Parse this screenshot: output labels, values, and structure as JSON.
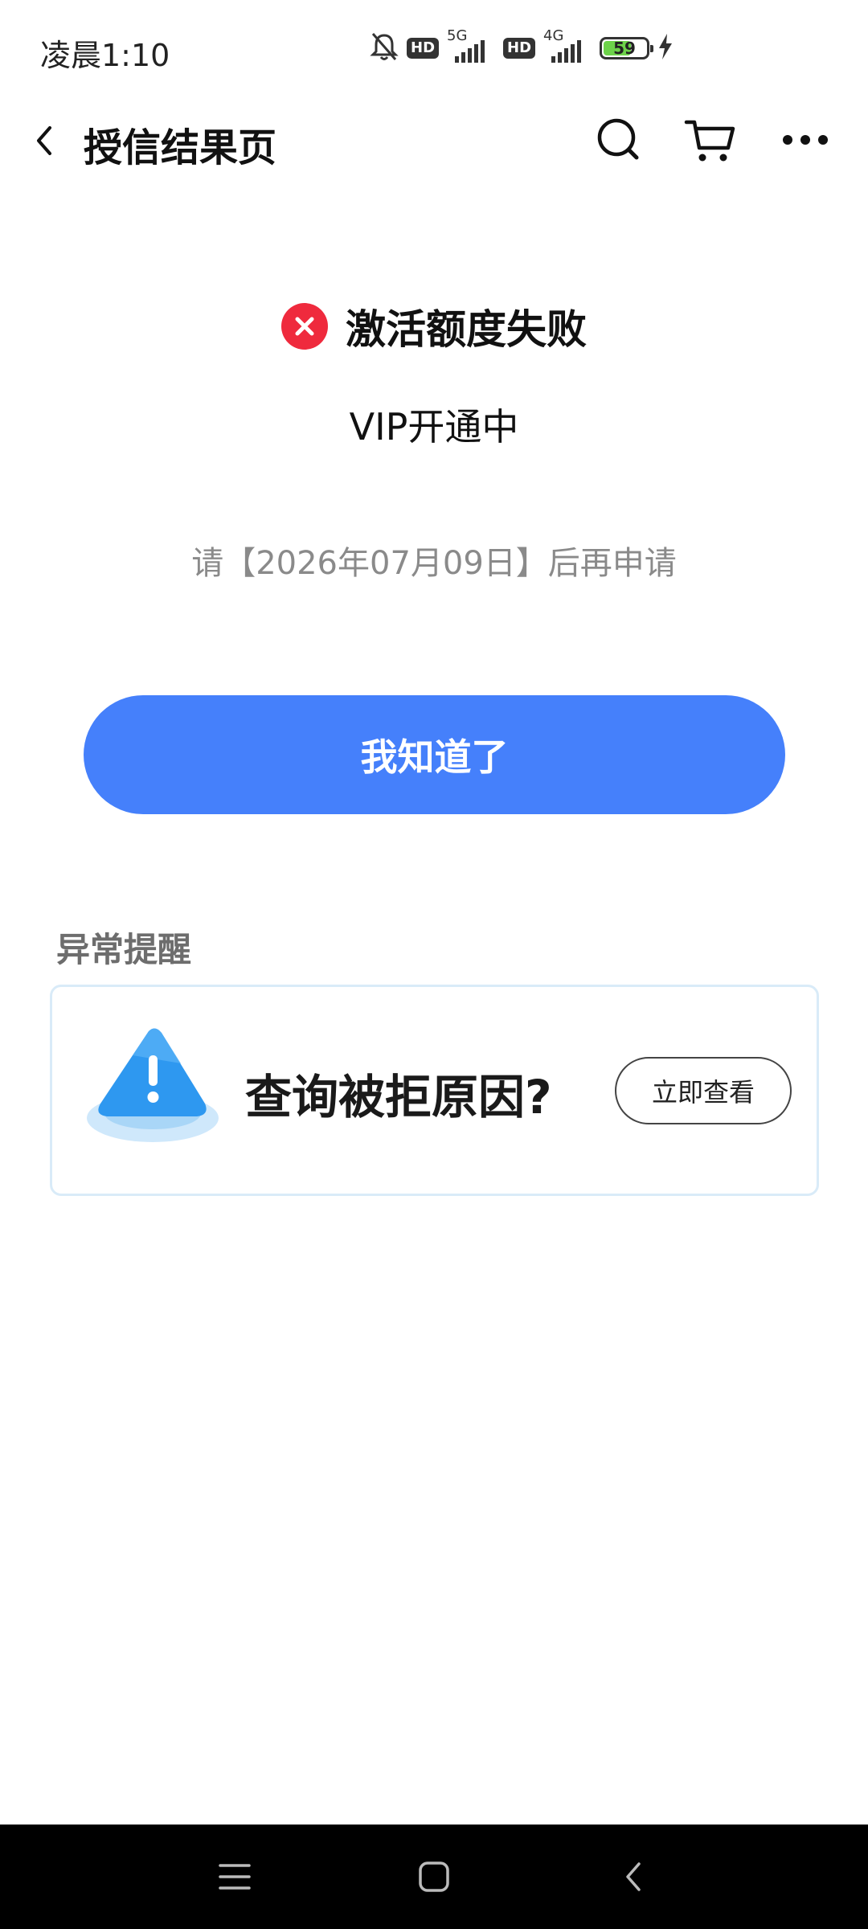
{
  "status_bar": {
    "time": "凌晨1:10",
    "hd1": "HD",
    "net1": "5G",
    "hd2": "HD",
    "net2": "4G",
    "battery": "59"
  },
  "header": {
    "title": "授信结果页"
  },
  "result": {
    "title": "激活额度失败",
    "subtitle": "VIP开通中",
    "notice": "请【2026年07月09日】后再申请",
    "button_label": "我知道了"
  },
  "alert": {
    "section_title": "异常提醒",
    "card_text": "查询被拒原因?",
    "button_label": "立即查看"
  },
  "colors": {
    "primary_button": "#4580fb",
    "fail_icon": "#ef2a3d",
    "alert_border": "#d9ebf8"
  }
}
